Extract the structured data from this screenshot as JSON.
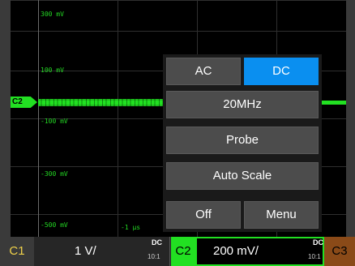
{
  "grid": {
    "volt_labels": [
      "300 mV",
      "100 mV",
      "-100 mV",
      "-300 mV",
      "-500 mV"
    ],
    "time_label": "-1 µs"
  },
  "trace": {
    "channel_marker": "C2",
    "color": "#22e022"
  },
  "menu": {
    "coupling_ac": "AC",
    "coupling_dc": "DC",
    "coupling_selected": "DC",
    "bandwidth": "20MHz",
    "probe": "Probe",
    "auto_scale": "Auto Scale",
    "off": "Off",
    "menu": "Menu"
  },
  "status_bar": {
    "c1": {
      "tag": "C1",
      "scale": "1 V/",
      "coupling": "DC",
      "attenuation": "10:1",
      "color": "#f0d24a"
    },
    "c2": {
      "tag": "C2",
      "scale": "200 mV/",
      "coupling": "DC",
      "attenuation": "10:1",
      "color": "#22e022"
    },
    "c3": {
      "tag": "C3",
      "color": "#8a4a18"
    }
  }
}
